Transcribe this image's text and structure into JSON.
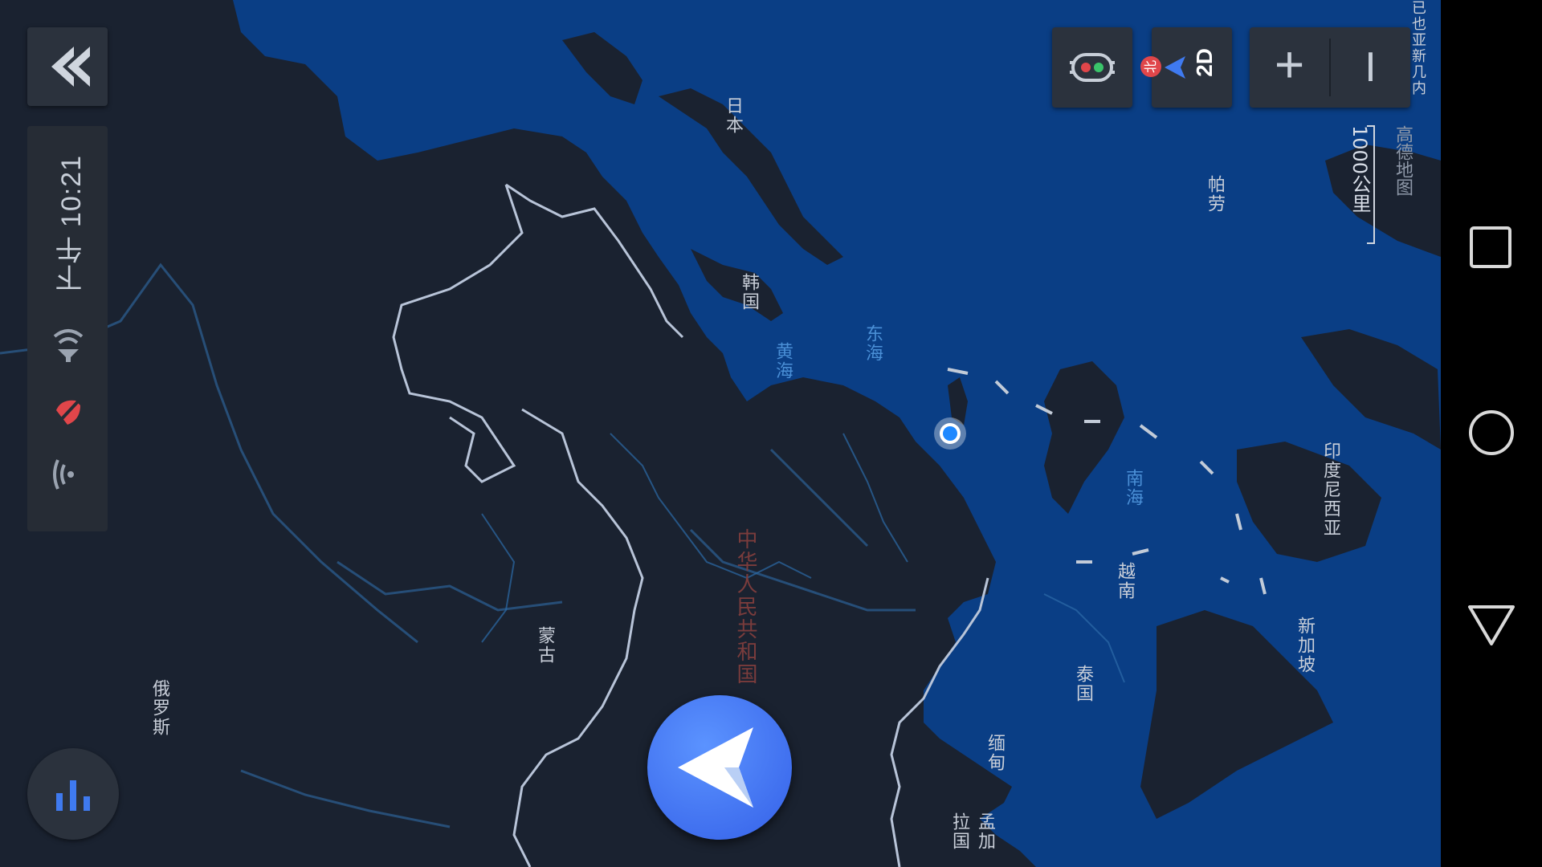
{
  "status_bar": {
    "time": "下午 10:21"
  },
  "map_labels": {
    "japan": "日本",
    "korea": "韩国",
    "yellow_sea": "黄海",
    "east_sea": "东海",
    "south_sea": "南海",
    "china": "中华人民共和国",
    "mongolia": "蒙古",
    "russia": "俄罗斯",
    "myanmar": "缅甸",
    "thailand": "泰国",
    "vietnam": "越南",
    "singapore": "新加坡",
    "indonesia": "印度尼西亚",
    "palau": "帕劳",
    "bangladesh": "孟加拉国",
    "cropped_top_right": "已也亚新几内"
  },
  "map_overlay": {
    "scale_text": "1000公里",
    "brand": "高德地图"
  },
  "controls": {
    "compass_north": "北",
    "view_mode": "2D",
    "zoom_in": "+",
    "zoom_out": "I"
  },
  "colors": {
    "land": "#1a2230",
    "sea": "#0a3e85",
    "border": "#b8c4d8",
    "accent_blue": "#3f7af0",
    "location_dot": "#1e88ff"
  },
  "icons": {
    "back": "double-chevron-left-icon",
    "traffic": "traffic-light-icon",
    "nav": "navigation-arrow-icon",
    "voice": "voice-bars-icon",
    "wifi": "wifi-icon",
    "mute": "mute-icon",
    "signal": "signal-icon"
  }
}
